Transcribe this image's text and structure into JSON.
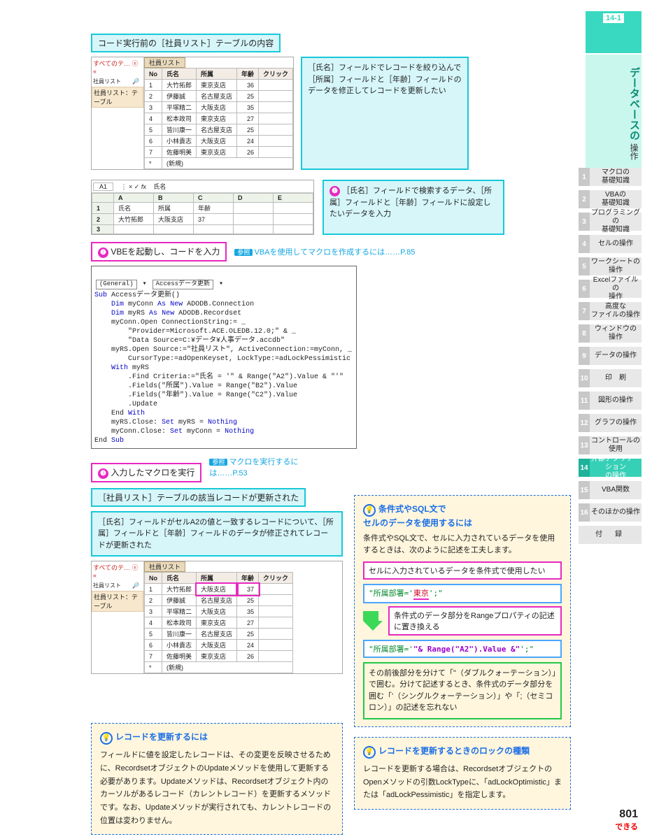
{
  "section": {
    "chapter": "14-1",
    "title_main": "データベースの",
    "title_sub": "操作"
  },
  "sidebar": {
    "items": [
      {
        "n": "1",
        "l": "マクロの\n基礎知識"
      },
      {
        "n": "2",
        "l": "VBAの\n基礎知識"
      },
      {
        "n": "3",
        "l": "プログラミングの\n基礎知識"
      },
      {
        "n": "4",
        "l": "セルの操作"
      },
      {
        "n": "5",
        "l": "ワークシートの\n操作"
      },
      {
        "n": "6",
        "l": "Excelファイルの\n操作"
      },
      {
        "n": "7",
        "l": "高度な\nファイルの操作"
      },
      {
        "n": "8",
        "l": "ウィンドウの\n操作"
      },
      {
        "n": "9",
        "l": "データの操作"
      },
      {
        "n": "10",
        "l": "印　刷"
      },
      {
        "n": "11",
        "l": "図形の操作"
      },
      {
        "n": "12",
        "l": "グラフの操作"
      },
      {
        "n": "13",
        "l": "コントロールの\n使用"
      },
      {
        "n": "14",
        "l": "外部アプリケーション\nの操作"
      },
      {
        "n": "15",
        "l": "VBA関数"
      },
      {
        "n": "16",
        "l": "そのほかの操作"
      }
    ],
    "active": 13,
    "appendix": "付　録"
  },
  "banner1": "コード実行前の［社員リスト］テーブルの内容",
  "callout1": "［氏名］フィールドでレコードを絞り込んで［所属］フィールドと［年齢］フィールドのデータを修正してレコードを更新したい",
  "access": {
    "nav_title": "すべてのテ…",
    "nav_item": "社員リスト：テーブル",
    "tab": "社員リスト",
    "cols": [
      "No",
      "氏名",
      "所属",
      "年齢",
      "クリック"
    ],
    "rows_before": [
      [
        "1",
        "大竹拓郎",
        "東京支店",
        "36",
        ""
      ],
      [
        "2",
        "伊藤誠",
        "名古屋支店",
        "25",
        ""
      ],
      [
        "3",
        "平塚精二",
        "大阪支店",
        "35",
        ""
      ],
      [
        "4",
        "松本政司",
        "東京支店",
        "27",
        ""
      ],
      [
        "5",
        "皆川康一",
        "名古屋支店",
        "25",
        ""
      ],
      [
        "6",
        "小林貴志",
        "大阪支店",
        "24",
        ""
      ],
      [
        "7",
        "佐藤明美",
        "東京支店",
        "26",
        ""
      ]
    ],
    "newrow": "(新規)",
    "rows_after": [
      [
        "1",
        "大竹拓郎",
        "大阪支店",
        "37",
        ""
      ],
      [
        "2",
        "伊藤誠",
        "名古屋支店",
        "25",
        ""
      ],
      [
        "3",
        "平塚精二",
        "大阪支店",
        "35",
        ""
      ],
      [
        "4",
        "松本政司",
        "東京支店",
        "27",
        ""
      ],
      [
        "5",
        "皆川康一",
        "名古屋支店",
        "25",
        ""
      ],
      [
        "6",
        "小林貴志",
        "大阪支店",
        "24",
        ""
      ],
      [
        "7",
        "佐藤明美",
        "東京支店",
        "26",
        ""
      ]
    ]
  },
  "step1": {
    "num": "❶",
    "text": "［氏名］フィールドで検索するデータ、［所属］フィールドと［年齢］フィールドに設定したいデータを入力"
  },
  "excel": {
    "cell": "A1",
    "fx": "氏名",
    "hdr": [
      "",
      "A",
      "B",
      "C",
      "D",
      "E"
    ],
    "r1": [
      "1",
      "氏名",
      "所属",
      "年齢",
      "",
      ""
    ],
    "r2": [
      "2",
      "大竹拓郎",
      "大阪支店",
      "37",
      "",
      ""
    ],
    "r3": [
      "3",
      "",
      "",
      "",
      "",
      ""
    ]
  },
  "step2": {
    "num": "❷",
    "text": "VBEを起動し、コードを入力"
  },
  "ref1": "VBAを使用してマクロを作成するには……P.85",
  "vbe": {
    "left": "(General)",
    "right": "Accessデータ更新",
    "code": "Sub Accessデータ更新()\n    Dim myConn As New ADODB.Connection\n    Dim myRS As New ADODB.Recordset\n    myConn.Open ConnectionString:= _\n        \"Provider=Microsoft.ACE.OLEDB.12.0;\" & _\n        \"Data Source=C:¥データ¥人事データ.accdb\"\n    myRS.Open Source:=\"社員リスト\", ActiveConnection:=myConn, _\n        CursorType:=adOpenKeyset, LockType:=adLockPessimistic\n    With myRS\n        .Find Criteria:=\"氏名 = '\" & Range(\"A2\").Value & \"'\"\n        .Fields(\"所属\").Value = Range(\"B2\").Value\n        .Fields(\"年齢\").Value = Range(\"C2\").Value\n        .Update\n    End With\n    myRS.Close: Set myRS = Nothing\n    myConn.Close: Set myConn = Nothing\nEnd Sub"
  },
  "step3": {
    "num": "❸",
    "text": "入力したマクロを実行"
  },
  "ref2": "マクロを実行するには……P.53",
  "banner2": "［社員リスト］テーブルの該当レコードが更新された",
  "callout2": "［氏名］フィールドがセルA2の値と一致するレコードについて、［所属］フィールドと［年齢］フィールドのデータが修正されてレコードが更新された",
  "hint1": {
    "title": "レコードを更新するには",
    "body": "フィールドに値を設定したレコードは、その変更を反映させるために、RecordsetオブジェクトのUpdateメソッドを使用して更新する必要があります。Updateメソッドは、Recordsetオブジェクト内のカーソルがあるレコード（カレントレコード）を更新するメソッドです。なお、Updateメソッドが実行されても、カレントレコードの位置は変わりません。"
  },
  "hint2": {
    "title": "条件式やSQL文で\nセルのデータを使用するには",
    "intro": "条件式やSQL文で、セルに入力されているデータを使用するときは、次のように記述を工夫します。",
    "box1": "セルに入力されているデータを条件式で使用したい",
    "sql1a": "\"所属部署='",
    "sql1b": "東京",
    "sql1c": "';\"",
    "box2": "条件式のデータ部分をRangeプロパティの記述に置き換える",
    "sql2a": "\"所属部署='",
    "sql2b": "\"& Range(\"A2\").Value &\"",
    "sql2c": "';\"",
    "box3": "その前後部分を分けて「\"（ダブルクォーテーション）」で囲む。分けて記述するとき、条件式のデータ部分を囲む「'（シングルクォーテーション）」や「;（セミコロン）」の記述を忘れない"
  },
  "hint3": {
    "title": "レコードを更新するときのロックの種類",
    "body": "レコードを更新する場合は、RecordsetオブジェクトのOpenメソッドの引数LockTypeに、「adLockOptimistic」または「adLockPessimistic」を指定します。"
  },
  "foot": {
    "page": "801",
    "brand": "できる"
  },
  "ref_label": "参照"
}
